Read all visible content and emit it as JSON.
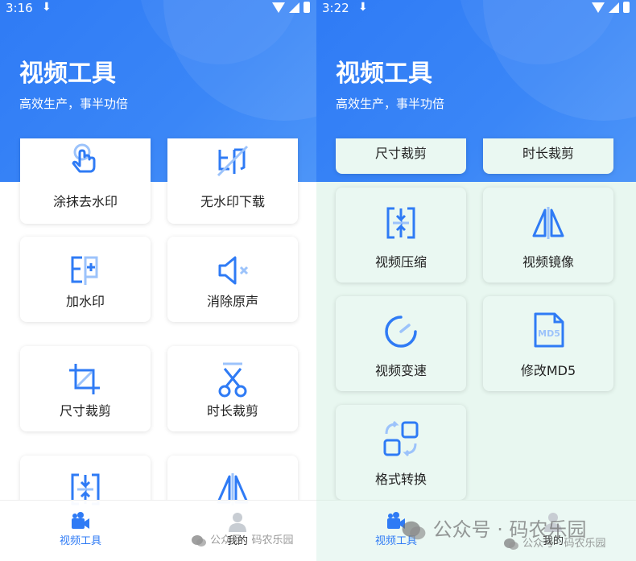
{
  "left": {
    "status": {
      "time": "3:16",
      "download": "⬇"
    },
    "header": {
      "title": "视频工具",
      "subtitle": "高效生产，事半功倍"
    },
    "cards": [
      {
        "label": "涂抹去水印",
        "icon": "tap-hand-icon"
      },
      {
        "label": "无水印下载",
        "icon": "no-watermark-icon"
      },
      {
        "label": "加水印",
        "icon": "add-watermark-icon"
      },
      {
        "label": "消除原声",
        "icon": "mute-icon"
      },
      {
        "label": "尺寸裁剪",
        "icon": "crop-icon"
      },
      {
        "label": "时长裁剪",
        "icon": "scissors-icon"
      },
      {
        "label": "",
        "icon": "compress-icon"
      },
      {
        "label": "",
        "icon": "mirror-icon"
      }
    ],
    "nav": [
      {
        "label": "视频工具",
        "active": true
      },
      {
        "label": "我的",
        "active": false
      }
    ],
    "watermark": "公众号 · 码农乐园"
  },
  "right": {
    "status": {
      "time": "3:22",
      "download": "⬇"
    },
    "header": {
      "title": "视频工具",
      "subtitle": "高效生产，事半功倍"
    },
    "cards": [
      {
        "label": "尺寸裁剪"
      },
      {
        "label": "时长裁剪"
      },
      {
        "label": "视频压缩",
        "icon": "compress-icon"
      },
      {
        "label": "视频镜像",
        "icon": "mirror-icon"
      },
      {
        "label": "视频变速",
        "icon": "speed-icon"
      },
      {
        "label": "修改MD5",
        "icon": "md5-file-icon",
        "icon_text": "MD5"
      },
      {
        "label": "格式转换",
        "icon": "convert-icon"
      }
    ],
    "nav": [
      {
        "label": "视频工具",
        "active": true
      },
      {
        "label": "我的",
        "active": false
      }
    ],
    "watermark_large": "公众号 · 码农乐园",
    "watermark": "公众号 · 码农乐园"
  },
  "colors": {
    "accent": "#2f7bf5",
    "icon_light": "#9cc3fb",
    "right_bg": "#e8f7f0"
  }
}
